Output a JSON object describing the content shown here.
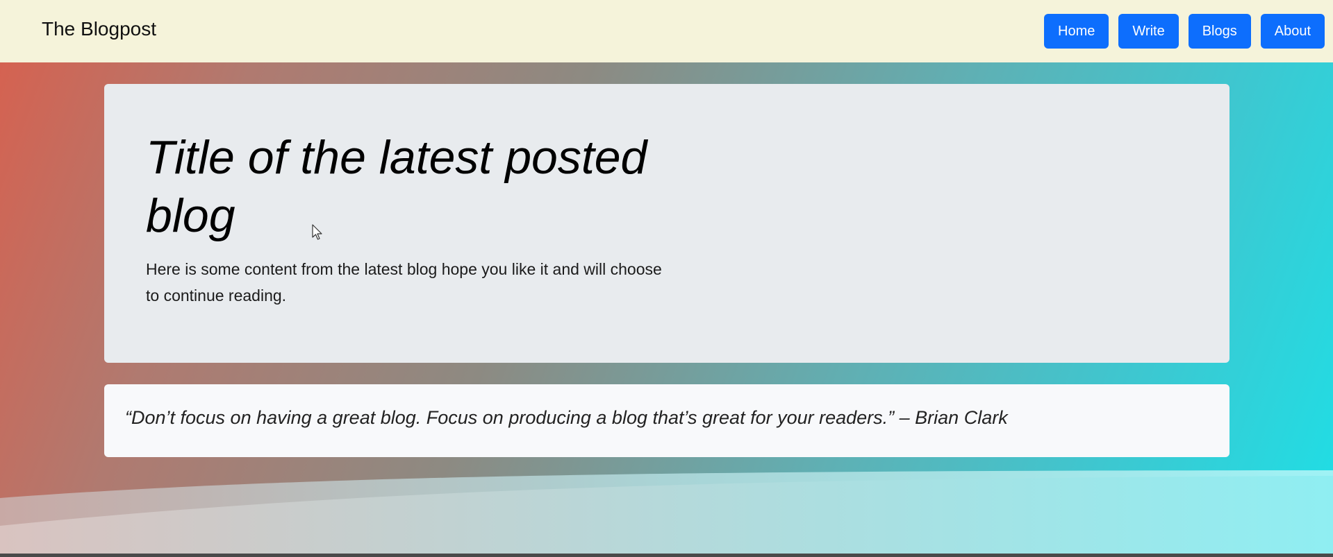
{
  "navbar": {
    "brand": "The Blogpost",
    "buttons": [
      {
        "label": "Home"
      },
      {
        "label": "Write"
      },
      {
        "label": "Blogs"
      },
      {
        "label": "About"
      }
    ],
    "background": "#f5f3da",
    "button_color": "#0d6efd"
  },
  "hero": {
    "title": "Title of the latest posted blog",
    "content": "Here is some content from the latest blog hope you like it and will choose to continue reading."
  },
  "quote": {
    "text": "“Don’t focus on having a great blog. Focus on producing a blog that’s great for your readers.” – Brian Clark"
  },
  "icons": {
    "cursor": "mouse-pointer-icon"
  }
}
